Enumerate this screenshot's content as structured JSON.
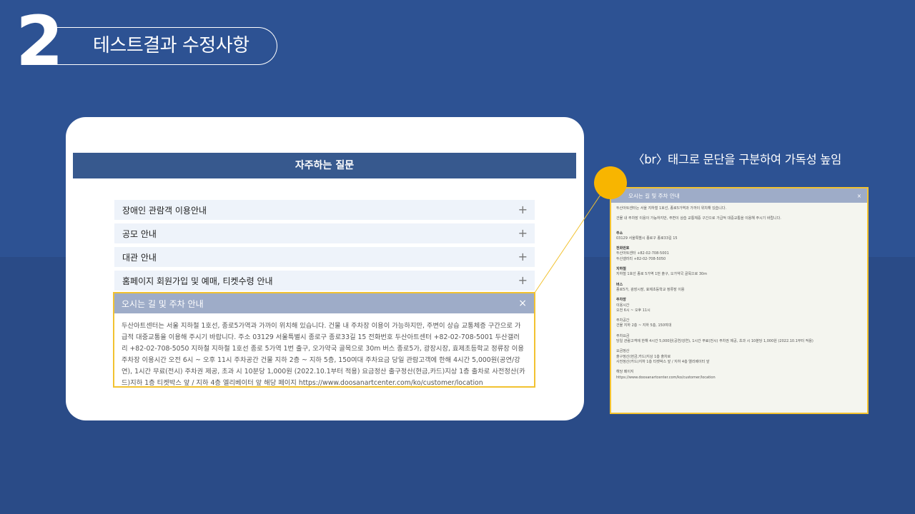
{
  "slide": {
    "number": "2",
    "title": "테스트결과 수정사항"
  },
  "faq": {
    "header": "자주하는 질문",
    "items": [
      {
        "label": "장애인 관람객 이용안내",
        "icon": "plus-icon",
        "glyph": "+"
      },
      {
        "label": "공모 안내",
        "icon": "plus-icon",
        "glyph": "+"
      },
      {
        "label": "대관 안내",
        "icon": "plus-icon",
        "glyph": "+"
      },
      {
        "label": "홈페이지 회원가입 및 예매, 티켓수령 안내",
        "icon": "plus-icon",
        "glyph": "+"
      }
    ],
    "open_item": {
      "label": "오시는 길 및 주차 안내",
      "close_glyph": "×",
      "body": "두산아트센터는 서울 지하철 1호선, 종로5가역과 가까이 위치해 있습니다. 건물 내 주차장 이용이 가능하지만, 주변이 상습 교통체증 구간으로 가급적 대중교통을 이용해 주시기 바랍니다. 주소 03129 서울특별시 종로구 종로33길 15 전화번호 두산아트센터 +82-02-708-5001 두산갤러리 +82-02-708-5050 지하철 지하철 1호선 종로 5가역 1번 출구, 오가약국 골목으로 30m 버스 종로5가, 광장시장, 효제초등학교 정류장 이용 주차장 이용시간 오전 6시 ~ 오후 11시 주차공간 건물 지하 2층 ~ 지하 5층, 150여대 주차요금 당일 관람고객에 한해 4시간 5,000원(공연/강연), 1시간 무료(전시) 주차권 제공, 초과 시 10분당 1,000원 (2022.10.1부터 적용) 요금정산 출구정산(현금,카드)지상 1층 출차로 사전정산(카드)지하 1층 티켓박스 앞 / 지하 4층 엘리베이터 앞 해당 페이지 https://www.doosanartcenter.com/ko/customer/location"
    }
  },
  "callout": {
    "label": "〈br〉태그로 문단을 구분하여 가독성 높임",
    "dot_color": "#f8b500",
    "highlight_color": "#f2c230"
  },
  "zoom": {
    "title": "오시는 길 및 주차 안내",
    "close_glyph": "×",
    "intro1": "두산아트센터는 서울 지하철 1호선, 종로5가역과 가까이 위치해 있습니다.",
    "intro2": "건물 내 주차장 이용이 가능하지만, 주변이 상습 교통체증 구간으로 가급적 대중교통을 이용해 주시기 바랍니다.",
    "address_label": "주소",
    "address": "03129 서울특별시 종로구 종로33길 15",
    "phone_label": "전화번호",
    "phone1": "두산아트센터 +82-02-708-5001",
    "phone2": "두산갤러리 +82-02-708-5050",
    "subway_label": "지하철",
    "subway": "지하철 1호선 종로 5가역 1번 출구, 오가약국 골목으로 30m",
    "bus_label": "버스",
    "bus": "종로5가, 광장시장, 효제초등학교 정류장 이용",
    "parking_label": "주차장",
    "parking_hours_label": "이용시간",
    "parking_hours": "오전 6시 ~ 오후 11시",
    "parking_space_label": "주차공간",
    "parking_space": "건물 지하 2층 ~ 지하 5층, 150여대",
    "fee_label": "주차요금",
    "fee": "당일 관람고객에 한해 4시간 5,000원(공연/강연), 1시간 무료(전시) 주차권 제공, 초과 시 10분당 1,000원 (2022.10.1부터 적용)",
    "pay_label": "요금정산",
    "pay1": "출구정산(현금,카드)지상 1층 출차로",
    "pay2": "사전정산(카드)지하 1층 티켓박스 앞 / 지하 4층 엘리베이터 앞",
    "page_label": "해당 페이지",
    "page_url": "https://www.doosanartcenter.com/ko/customer/location"
  }
}
